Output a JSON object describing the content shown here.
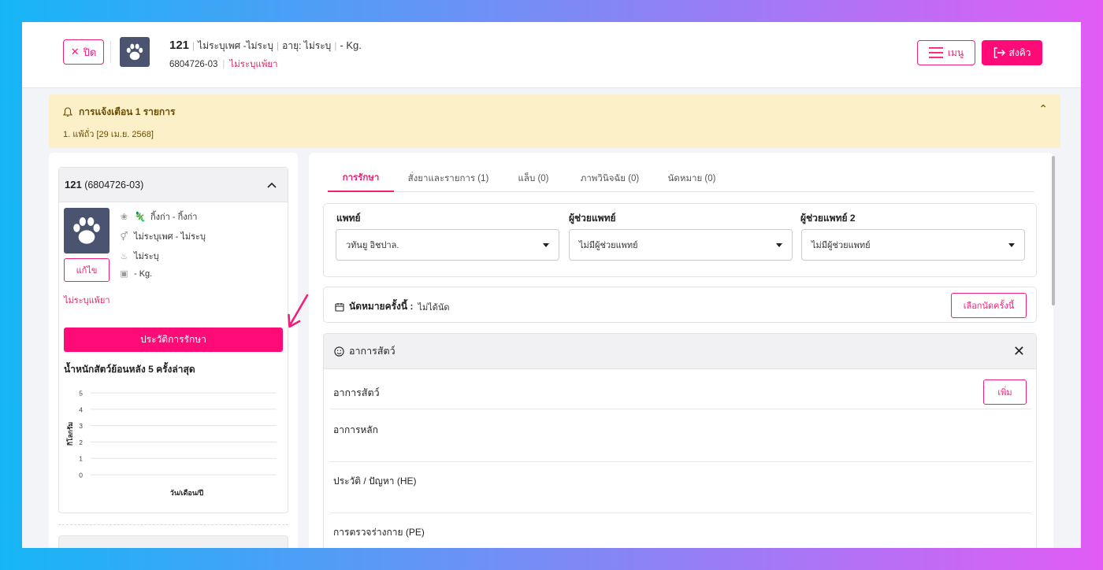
{
  "header": {
    "close_label": "ปิด",
    "pet_name": "121",
    "gender_sex": "ไม่ระบุเพศ -ไม่ระบุ",
    "age": "อายุ: ไม่ระบุ",
    "weight": "- Kg.",
    "pet_code": "6804726-03",
    "allergy": "ไม่ระบุแพ้ยา",
    "menu_label": "เมนู",
    "send_label": "ส่งคิว"
  },
  "notice": {
    "title": "การแจ้งเตือน 1 รายการ",
    "items": [
      "1. แพ้ถั่ว [29 เม.ย. 2568]"
    ]
  },
  "pet_card": {
    "title_name": "121",
    "title_code": "(6804726-03)",
    "species": "กิ้งก่า - กิ้งก่า",
    "gender": "ไม่ระบุเพศ - ไม่ระบุ",
    "birth": "ไม่ระบุ",
    "weight": "- Kg.",
    "edit_label": "แก้ไข",
    "allergy": "ไม่ระบุแพ้ยา",
    "history_label": "ประวัติการรักษา",
    "weight_title": "น้ำหนักสัตว์ย้อนหลัง 5 ครั้งล่าสุด"
  },
  "chart_data": {
    "type": "line",
    "title": "น้ำหนักสัตว์ย้อนหลัง 5 ครั้งล่าสุด",
    "x": [],
    "series": [],
    "xlabel": "วัน/เดือน/ปี",
    "ylabel": "กิโลกรัม",
    "ylim": [
      0,
      5
    ],
    "yticks": [
      "0",
      "1",
      "2",
      "3",
      "4",
      "5"
    ],
    "grid": true
  },
  "tabs": [
    {
      "label": "การรักษา",
      "active": true
    },
    {
      "label": "สั่งยาและรายการ (1)",
      "active": false
    },
    {
      "label": "แล็บ (0)",
      "active": false
    },
    {
      "label": "ภาพวินิจฉัย (0)",
      "active": false
    },
    {
      "label": "นัดหมาย (0)",
      "active": false
    }
  ],
  "doctors": {
    "vet_label": "แพทย์",
    "vet_value": "วทันยู อิชปาล.",
    "asst_label": "ผู้ช่วยแพทย์",
    "asst_value": "ไม่มีผู้ช่วยแพทย์",
    "asst2_label": "ผู้ช่วยแพทย์ 2",
    "asst2_value": "ไม่มีผู้ช่วยแพทย์"
  },
  "appointment": {
    "label": "นัดหมายครั้งนี้ :",
    "value": "ไม่ได้นัด",
    "button_label": "เลือกนัดครั้งนี้"
  },
  "symptoms": {
    "header": "อาการสัตว์",
    "subheader": "อาการสัตว์",
    "add_label": "เพิ่ม",
    "main_label": "อาการหลัก",
    "history_label": "ประวัติ / ปัญหา (HE)",
    "pe_label": "การตรวจร่างกาย (PE)"
  },
  "colors": {
    "accent": "#fe0b78",
    "notice_bg": "#fbf0c7",
    "avatar_bg": "#4a5470"
  }
}
